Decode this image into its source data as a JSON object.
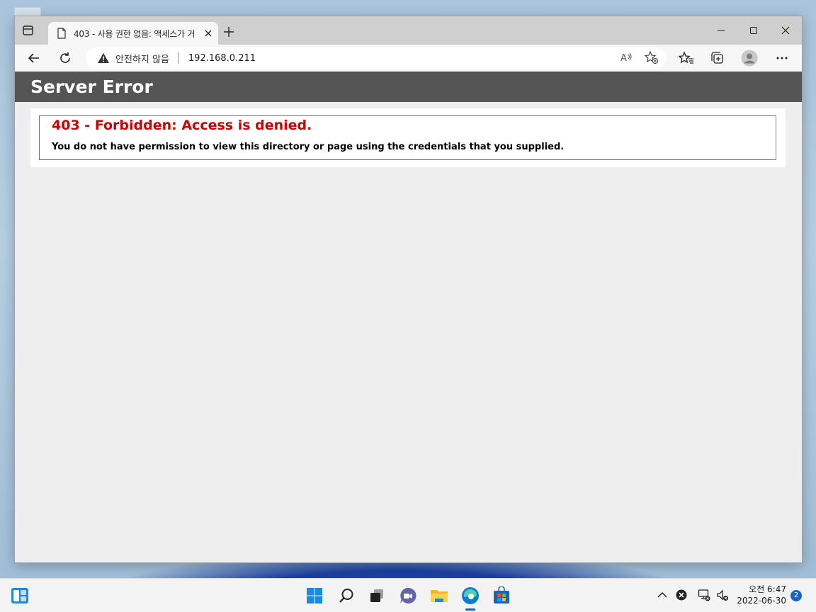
{
  "browser": {
    "tab_title": "403 - 사용 권한 없음: 액세스가 거",
    "address": {
      "security_label": "안전하지 않음",
      "url": "192.168.0.211"
    }
  },
  "page": {
    "header_title": "Server Error",
    "error_title": "403 - Forbidden: Access is denied.",
    "error_message": "You do not have permission to view this directory or page using the credentials that you supplied."
  },
  "taskbar": {
    "clock_time": "오전 6:47",
    "clock_date": "2022-06-30",
    "notification_count": "2",
    "pinned": [
      "widgets-icon",
      "start-icon",
      "search-icon",
      "task-view-icon",
      "chat-icon",
      "file-explorer-icon",
      "edge-icon",
      "store-icon"
    ]
  },
  "colors": {
    "error_red": "#cc0000",
    "header_gray": "#555555",
    "accent_blue": "#1565c0"
  }
}
